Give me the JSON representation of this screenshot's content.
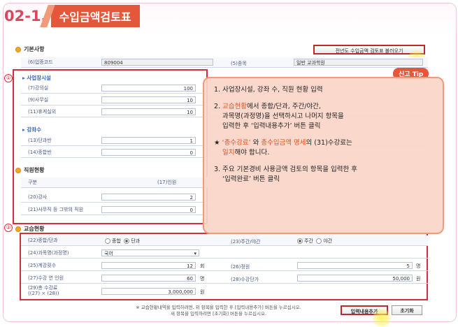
{
  "header": {
    "section_num": "02-1.",
    "title": "수입금액검토표"
  },
  "basic": {
    "heading": "기본사항",
    "load_button": "전년도 수입금액 검토표 불러오기",
    "industry_code_label": "(6)업종코드",
    "industry_code_value": "809004",
    "type_label": "(5)종목",
    "type_value": "일반 교과학원"
  },
  "facilities": {
    "heading": "사업장시설",
    "rows": [
      {
        "label": "(7)강의실",
        "value": "100"
      },
      {
        "label": "(9)사무실",
        "value": "10"
      },
      {
        "label": "(11)휴게실외",
        "value": "10"
      }
    ]
  },
  "classes": {
    "heading": "강좌수",
    "rows": [
      {
        "label": "(13)단과반",
        "value": "1"
      },
      {
        "label": "(14)종합반",
        "value": "0"
      }
    ]
  },
  "staff": {
    "heading": "직원현황",
    "col_type": "구분",
    "col_count": "(17)인원",
    "rows": [
      {
        "label": "(20)강사",
        "value": "2"
      },
      {
        "label": "(21)사무직 등 그밖의 직원",
        "value": "0"
      }
    ]
  },
  "tuition": {
    "heading": "교습현황",
    "general_label": "(22)종합/단과",
    "opt_general": "종합",
    "opt_single": "단과",
    "daynight_label": "(23)주간/야간",
    "opt_day": "주간",
    "opt_night": "야간",
    "subject_label": "(24)과목명(과정명)",
    "subject_value": "국어",
    "weeks_label": "(25)계강횟수",
    "weeks_value": "12",
    "weeks_unit": "회",
    "capacity_label": "(26)정원",
    "capacity_value": "5",
    "capacity_unit": "명",
    "students_label": "(27)수강 연 인원",
    "students_value": "60",
    "students_unit": "명",
    "unit_price_label": "(28)수강단가",
    "unit_price_value": "50,000",
    "unit_price_unit": "원",
    "total_label_1": "(29)총 수강료",
    "total_label_2": "((27) × (28))",
    "total_value": "3,000,000",
    "total_unit": "원"
  },
  "footer": {
    "note_1": "※ 교습현황내역을 입력하려면, 위 항목을 입력한 후 [입력내용추가] 버튼을 누르십시오.",
    "note_2": "새 항목을 입력하려면 [초기화] 버튼을 누르십시오.",
    "add_button": "입력내용추가",
    "reset_button": "초기화"
  },
  "markers": {
    "one": "①",
    "two": "②"
  },
  "tip": {
    "badge": "신고 Tip",
    "item1": "1. 사업장시설, 강좌 수, 직원 현황 입력",
    "item2_a": "2. ",
    "item2_accent": "교습현황",
    "item2_b": "에서 종합/단과, 주간/야간,",
    "item2_line2": "과목명(과정명)을 선택하시고 나머지 항목을",
    "item2_line3": "입력한 후 ‘입력내용추가’ 버튼 클릭",
    "star_a": "★ ",
    "star_accent1": "‘총수강료’",
    "star_b": " 와 ",
    "star_accent2": "총수입금액 명세",
    "star_c": "의 (31)수강료는",
    "star_accent3": "일치",
    "star_d": "해야 합니다.",
    "item3_line1": "3. 주요 기본경비 사용금액 검토의 항목을 입력한 후",
    "item3_line2": "‘입력완료’ 버튼 클릭"
  }
}
